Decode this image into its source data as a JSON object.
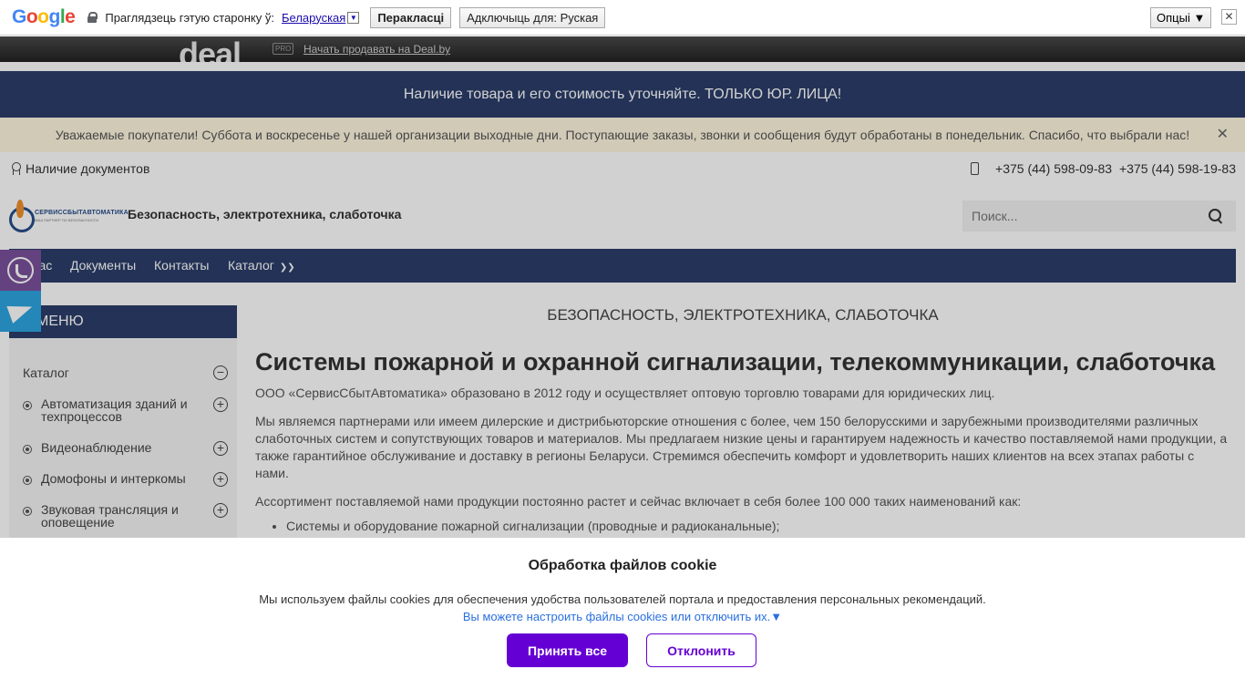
{
  "translate_bar": {
    "prompt": "Праглядзець гэтую старонку ў:",
    "language": "Беларуская",
    "translate_btn": "Перакласці",
    "disable_btn": "Адключыць для: Руская",
    "options_btn": "Опцыі ▼",
    "close": "✕"
  },
  "deal_bar": {
    "logo": "deal",
    "pro_badge": "PRO",
    "link": "Начать продавать на Deal.by"
  },
  "notice": "Наличие товара и его стоимость уточняйте. ТОЛЬКО ЮР. ЛИЦА!",
  "warning": {
    "text": "Уважаемые покупатели! Суббота и воскресенье у нашей организации выходные дни. Поступающие заказы, звонки и сообщения будут обработаны в понедельник. Спасибо, что выбрали нас!",
    "close": "✕"
  },
  "topline": {
    "docs_link": "Наличие документов",
    "phone1": "+375 (44) 598-09-83",
    "phone2": "+375 (44) 598-19-83"
  },
  "header": {
    "logo_text": "СЕРВИССБЫТАВТОМАТИКА",
    "logo_sub": "ВАШ ПАРТНЕР ПО БЕЗОПАСНОСТИ",
    "slogan": "Безопасность, электротехника, слаботочка",
    "search_placeholder": "Поиск..."
  },
  "nav": {
    "items": [
      "О нас",
      "Документы",
      "Контакты",
      "Каталог"
    ]
  },
  "sidebar": {
    "heading": "МЕНЮ",
    "catalog": "Каталог",
    "items": [
      "Автоматизация зданий и техпроцессов",
      "Видеонаблюдение",
      "Домофоны и интеркомы",
      "Звуковая трансляция и оповещение"
    ]
  },
  "content": {
    "kicker": "БЕЗОПАСНОСТЬ, ЭЛЕКТРОТЕХНИКА, СЛАБОТОЧКА",
    "title": "Системы пожарной и охранной сигнализации, телекоммуникации, слаботочка",
    "p1": "ООО «СервисСбытАвтоматика» образовано в 2012 году и осуществляет оптовую торговлю товарами для юридических лиц.",
    "p2": "Мы являемся партнерами или имеем дилерские и дистрибьюторские отношения с более, чем 150 белорусскими и зарубежными производителями различных слаботочных систем и сопутствующих товаров и материалов. Мы предлагаем низкие цены и гарантируем надежность и качество поставляемой нами продукции, а также гарантийное обслуживание и доставку в регионы Беларуси. Стремимся обеспечить комфорт и удовлетворить наших клиентов на всех этапах работы с нами.",
    "p3": "Ассортимент поставляемой нами продукции постоянно растет и сейчас включает в себя более 100 000 таких наименований как:",
    "list": [
      "Системы и оборудование пожарной сигнализации (проводные и радиоканальные);"
    ]
  },
  "cookie": {
    "title": "Обработка файлов cookie",
    "text": "Мы используем файлы cookies для обеспечения удобства пользователей портала и предоставления персональных рекомендаций.",
    "link": "Вы можете настроить файлы cookies или отключить их.▼",
    "accept": "Принять все",
    "decline": "Отклонить"
  },
  "colors": {
    "brand_navy": "#2b3e6a",
    "accent_purple": "#6500d4",
    "viber": "#7b519d",
    "telegram": "#2ca5e0"
  }
}
